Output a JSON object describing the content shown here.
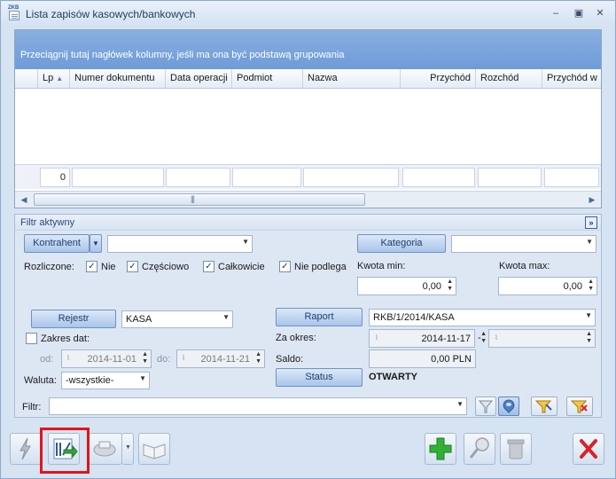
{
  "window": {
    "title": "Lista zapisów kasowych/bankowych",
    "app_icon_label": "ZKB",
    "minimize_icon": "minimize-icon",
    "maximize_icon": "maximize-icon",
    "close_icon": "close-icon"
  },
  "grid": {
    "group_hint": "Przeciągnij tutaj nagłówek kolumny, jeśli ma ona być podstawą grupowania",
    "columns": [
      "Lp",
      "Numer dokumentu",
      "Data operacji",
      "Podmiot",
      "Nazwa",
      "Przychód",
      "Rozchód",
      "Przychód w"
    ],
    "sort_indicator": "▲",
    "summary_count": "0"
  },
  "filter": {
    "title": "Filtr aktywny",
    "kontrahent_label": "Kontrahent",
    "kontrahent_value": "",
    "kategoria_label": "Kategoria",
    "kategoria_value": "",
    "rozliczone_label": "Rozliczone:",
    "checks": [
      {
        "label": "Nie",
        "checked": true
      },
      {
        "label": "Częściowo",
        "checked": true
      },
      {
        "label": "Całkowicie",
        "checked": true
      },
      {
        "label": "Nie podlega",
        "checked": true
      }
    ],
    "kwota_min_label": "Kwota min:",
    "kwota_min_value": "0,00",
    "kwota_max_label": "Kwota max:",
    "kwota_max_value": "0,00",
    "rejestr_label": "Rejestr",
    "rejestr_value": "KASA",
    "raport_label": "Raport",
    "raport_value": "RKB/1/2014/KASA",
    "zakres_dat_label": "Zakres dat:",
    "od_label": "od:",
    "od_value": "2014-11-01",
    "do_label": "do:",
    "do_value": "2014-11-21",
    "za_okres_label": "Za okres:",
    "za_okres_from": "2014-11-17",
    "za_okres_sep": "-",
    "za_okres_to": "",
    "saldo_label": "Saldo:",
    "saldo_value": "0,00 PLN",
    "waluta_label": "Waluta:",
    "waluta_value": "-wszystkie-",
    "status_label": "Status",
    "status_value": "OTWARTY",
    "filtr_label": "Filtr:",
    "filtr_value": ""
  },
  "colors": {
    "group_bar": "#7ea5dc",
    "accent_green": "#2fa82f",
    "accent_red": "#d8232a",
    "highlight": "#e3141b"
  }
}
